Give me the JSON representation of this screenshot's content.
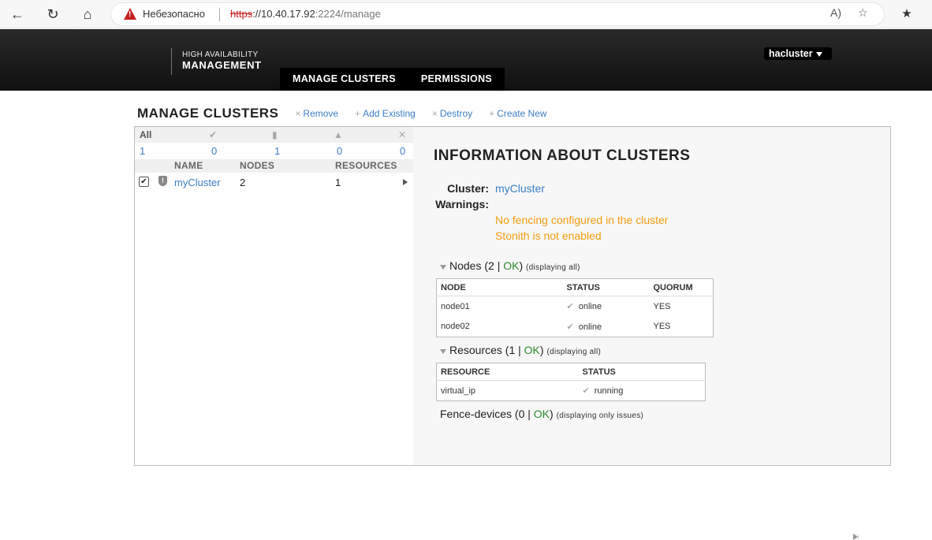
{
  "browser": {
    "security_label": "Небезопасно",
    "url_proto": "https",
    "url_host": "://10.40.17.92",
    "url_path": ":2224/manage"
  },
  "header": {
    "brand_line1": "HIGH AVAILABILITY",
    "brand_line2": "MANAGEMENT",
    "tabs": [
      "MANAGE CLUSTERS",
      "PERMISSIONS"
    ],
    "user": "hacluster"
  },
  "toolbar": {
    "title": "MANAGE CLUSTERS",
    "actions": [
      {
        "icon": "×",
        "label": "Remove"
      },
      {
        "icon": "+",
        "label": "Add Existing"
      },
      {
        "icon": "×",
        "label": "Destroy"
      },
      {
        "icon": "+",
        "label": "Create New"
      }
    ]
  },
  "summary": {
    "all_label": "All",
    "counts": {
      "all": "1",
      "ok": "0",
      "warning": "1",
      "error": "0",
      "failed": "0"
    }
  },
  "cluster_list": {
    "columns": [
      "NAME",
      "NODES",
      "RESOURCES"
    ],
    "rows": [
      {
        "checked": true,
        "name": "myCluster",
        "nodes": "2",
        "resources": "1"
      }
    ]
  },
  "info": {
    "title": "INFORMATION ABOUT CLUSTERS",
    "cluster_label": "Cluster:",
    "cluster_value": "myCluster",
    "warnings_label": "Warnings:",
    "warnings": [
      "No fencing configured in the cluster",
      "Stonith is not enabled"
    ],
    "nodes_section": {
      "label": "Nodes (2 | ",
      "status": "OK",
      "close": ")",
      "note": "(displaying all)"
    },
    "nodes_table": {
      "headers": [
        "NODE",
        "STATUS",
        "QUORUM"
      ],
      "rows": [
        {
          "node": "node01",
          "status": "online",
          "quorum": "YES"
        },
        {
          "node": "node02",
          "status": "online",
          "quorum": "YES"
        }
      ]
    },
    "resources_section": {
      "label": "Resources (1 | ",
      "status": "OK",
      "close": ")",
      "note": "(displaying all)"
    },
    "resources_table": {
      "headers": [
        "RESOURCE",
        "STATUS"
      ],
      "rows": [
        {
          "resource": "virtual_ip",
          "status": "running"
        }
      ]
    },
    "fence_section": {
      "label": "Fence-devices (0 | ",
      "status": "OK",
      "close": ")",
      "note": "(displaying only issues)"
    }
  }
}
